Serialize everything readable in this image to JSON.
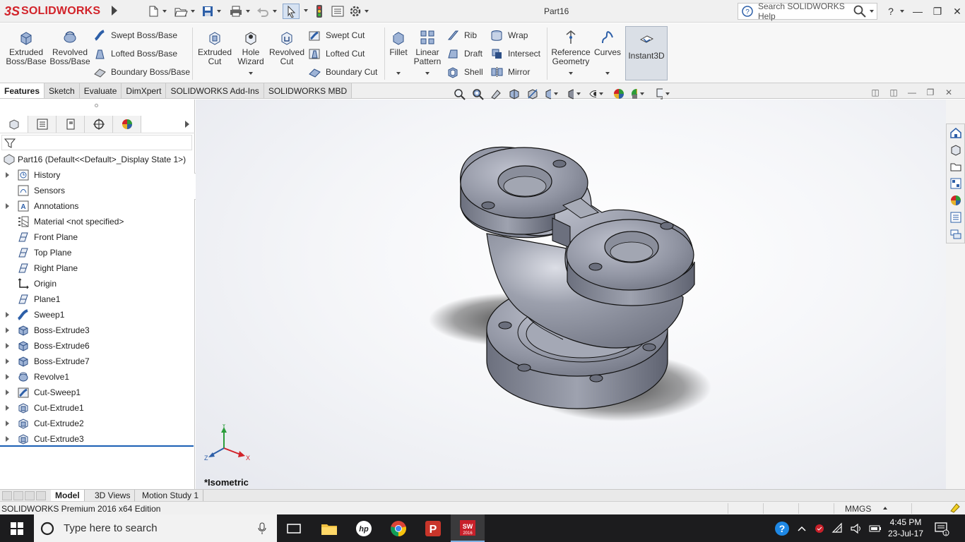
{
  "app": {
    "logo_ds": "3S",
    "logo_name": "SOLIDWORKS",
    "document_title": "Part16",
    "help_search_placeholder": "Search SOLIDWORKS Help",
    "help_label": "?"
  },
  "ribbon": {
    "extruded_boss": "Extruded Boss/Base",
    "revolved_boss": "Revolved Boss/Base",
    "swept_boss": "Swept Boss/Base",
    "lofted_boss": "Lofted Boss/Base",
    "boundary_boss": "Boundary Boss/Base",
    "extruded_cut": "Extruded Cut",
    "hole_wizard": "Hole Wizard",
    "revolved_cut": "Revolved Cut",
    "swept_cut": "Swept Cut",
    "lofted_cut": "Lofted Cut",
    "boundary_cut": "Boundary Cut",
    "fillet": "Fillet",
    "linear_pattern": "Linear Pattern",
    "rib": "Rib",
    "draft": "Draft",
    "shell": "Shell",
    "wrap": "Wrap",
    "intersect": "Intersect",
    "mirror": "Mirror",
    "reference_geometry": "Reference Geometry",
    "curves": "Curves",
    "instant3d": "Instant3D"
  },
  "command_tabs": [
    "Features",
    "Sketch",
    "Evaluate",
    "DimXpert",
    "SOLIDWORKS Add-Ins",
    "SOLIDWORKS MBD"
  ],
  "feature_tree": {
    "root": "Part16  (Default<<Default>_Display State 1>)",
    "items": [
      {
        "label": "History",
        "expandable": true,
        "icon": "history-icon"
      },
      {
        "label": "Sensors",
        "expandable": false,
        "icon": "sensors-icon"
      },
      {
        "label": "Annotations",
        "expandable": true,
        "icon": "annotations-icon"
      },
      {
        "label": "Material <not specified>",
        "expandable": false,
        "icon": "material-icon"
      },
      {
        "label": "Front Plane",
        "expandable": false,
        "icon": "plane-icon"
      },
      {
        "label": "Top Plane",
        "expandable": false,
        "icon": "plane-icon"
      },
      {
        "label": "Right Plane",
        "expandable": false,
        "icon": "plane-icon"
      },
      {
        "label": "Origin",
        "expandable": false,
        "icon": "origin-icon"
      },
      {
        "label": "Plane1",
        "expandable": false,
        "icon": "plane-icon"
      },
      {
        "label": "Sweep1",
        "expandable": true,
        "icon": "sweep-icon"
      },
      {
        "label": "Boss-Extrude3",
        "expandable": true,
        "icon": "extrude-icon"
      },
      {
        "label": "Boss-Extrude6",
        "expandable": true,
        "icon": "extrude-icon"
      },
      {
        "label": "Boss-Extrude7",
        "expandable": true,
        "icon": "extrude-icon"
      },
      {
        "label": "Revolve1",
        "expandable": true,
        "icon": "revolve-icon"
      },
      {
        "label": "Cut-Sweep1",
        "expandable": true,
        "icon": "cut-sweep-icon"
      },
      {
        "label": "Cut-Extrude1",
        "expandable": true,
        "icon": "cut-extrude-icon"
      },
      {
        "label": "Cut-Extrude2",
        "expandable": true,
        "icon": "cut-extrude-icon"
      },
      {
        "label": "Cut-Extrude3",
        "expandable": true,
        "icon": "cut-extrude-icon"
      }
    ]
  },
  "graphics": {
    "view_orientation": "*Isometric",
    "triad_x": "X",
    "triad_y": "Y",
    "triad_z": "Z"
  },
  "bottom_tabs": [
    "Model",
    "3D Views",
    "Motion Study 1"
  ],
  "status_bar": {
    "edition": "SOLIDWORKS Premium 2016 x64 Edition",
    "units": "MMGS"
  },
  "taskbar": {
    "search_placeholder": "Type here to search",
    "time": "4:45 PM",
    "date": "23-Jul-17"
  },
  "colors": {
    "brand_red": "#d2232a",
    "part_gray": "#8c8f9c",
    "accent_blue": "#1a5fb4"
  }
}
